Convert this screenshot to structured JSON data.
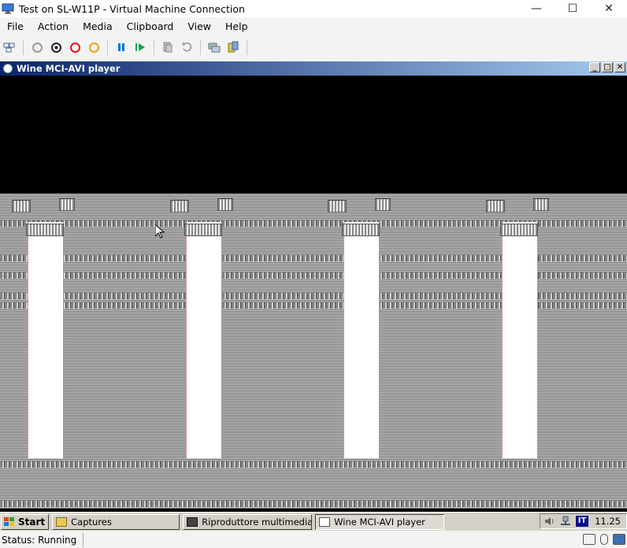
{
  "host_window": {
    "title": "Test on SL-W11P - Virtual Machine Connection",
    "controls": {
      "minimize": "—",
      "maximize": "☐",
      "close": "✕"
    }
  },
  "menu": {
    "items": [
      "File",
      "Action",
      "Media",
      "Clipboard",
      "View",
      "Help"
    ]
  },
  "toolbar": {
    "buttons": [
      "ctrl-alt-del-icon",
      "start-icon",
      "turn-off-icon",
      "shutdown-icon",
      "save-icon",
      "pause-icon",
      "reset-icon",
      "checkpoint-icon",
      "revert-icon",
      "enhanced-session-icon",
      "share-icon"
    ],
    "colors": {
      "turn_off": "#e81123",
      "shutdown": "#f0a30a",
      "pause": "#0078d4",
      "reset": "#16a34a"
    }
  },
  "guest_window": {
    "title": "Wine MCI-AVI player",
    "controls": {
      "minimize": "_",
      "maximize": "□",
      "close": "✕"
    }
  },
  "taskbar": {
    "start_label": "Start",
    "tasks": [
      {
        "label": "Captures",
        "active": false
      },
      {
        "label": "Riproduttore multimediale R...",
        "active": false
      },
      {
        "label": "Wine MCI-AVI player",
        "active": true
      }
    ],
    "tray": {
      "language": "IT",
      "clock": "11.25"
    }
  },
  "status": {
    "text": "Status: Running"
  }
}
